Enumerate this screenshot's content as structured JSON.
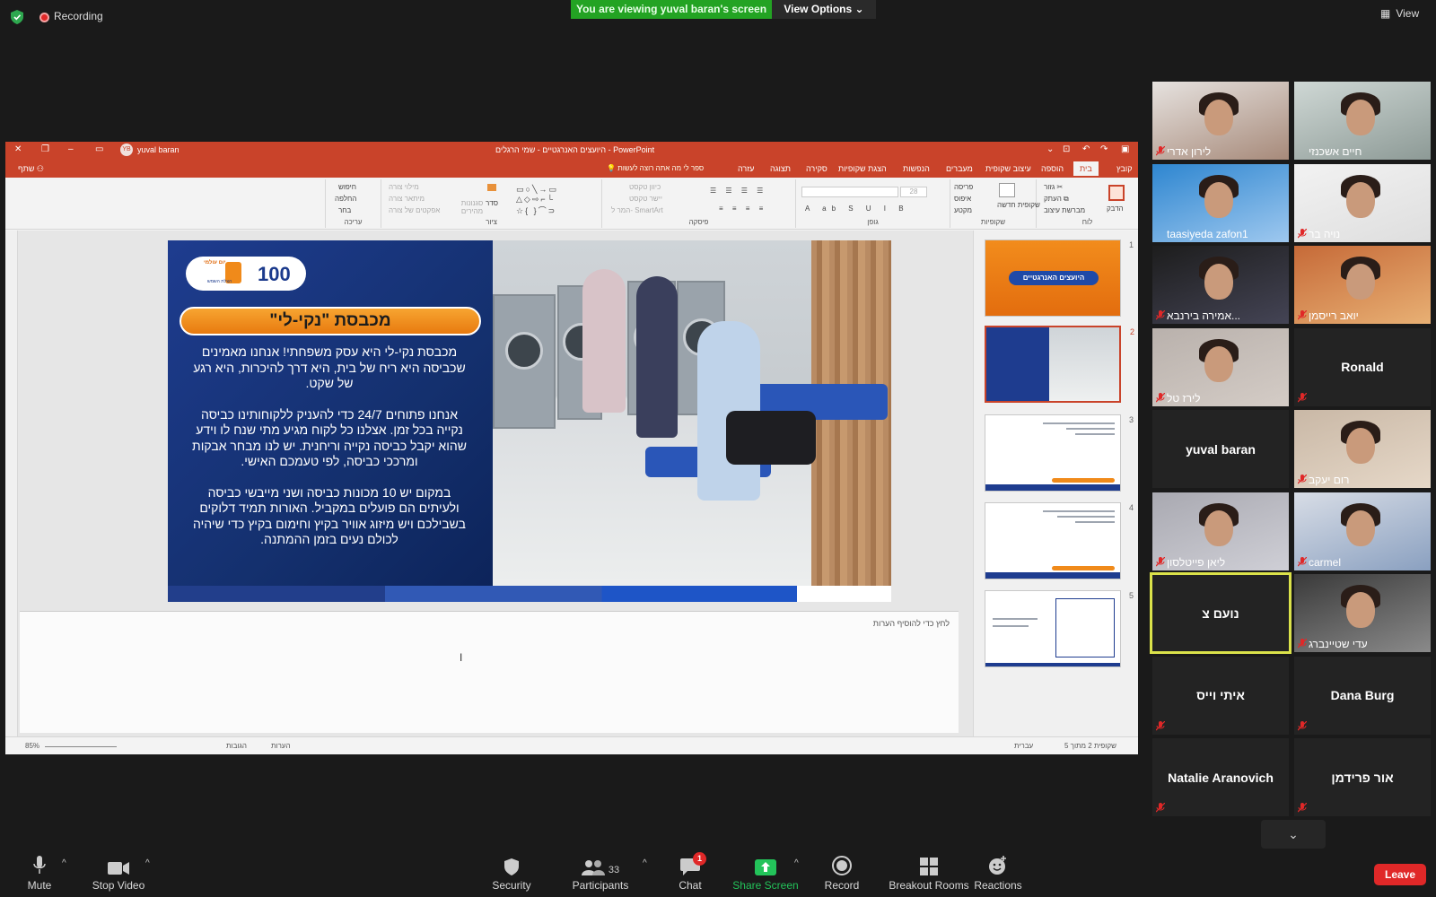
{
  "topbar": {
    "recording": "Recording",
    "viewing_banner": "You are viewing yuval baran's screen",
    "view_options": "View Options",
    "view": "View"
  },
  "ppt": {
    "title": "היועצים האנרגטיים - שמי הרגלים - PowerPoint",
    "user": "yuval baran",
    "user_initials": "YB",
    "share": "שתף",
    "tell_me": "ספר לי מה אתה רוצה לעשות",
    "tabs": [
      "קובץ",
      "בית",
      "הוספה",
      "עיצוב שקופית",
      "מעברים",
      "הנפשות",
      "הצגת שקופיות",
      "סקירה",
      "תצוגה",
      "עזרה"
    ],
    "ribbon": {
      "clipboard": {
        "paste": "הדבק",
        "cut": "גזור",
        "copy": "העתק",
        "format_painter": "מברשת עיצוב",
        "label": "לוח"
      },
      "slides": {
        "new_slide": "שקופית חדשה",
        "layout": "פריסה",
        "reset": "איפוס",
        "section": "מקטע",
        "label": "שקופיות"
      },
      "font": {
        "size": "28",
        "label": "גופן"
      },
      "paragraph": {
        "text_direction": "כיוון טקסט",
        "align_text": "יישר טקסט",
        "smartart": "המר ל- SmartArt",
        "label": "פיסקה"
      },
      "drawing": {
        "arrange": "סדר",
        "quick_styles": "סגנונות מהירים",
        "shape_fill": "מילוי צורה",
        "shape_outline": "מיתאר צורה",
        "shape_effects": "אפקטים של צורה",
        "label": "ציור"
      },
      "editing": {
        "find": "חיפוש",
        "replace": "החלפה",
        "select": "בחר",
        "label": "עריכה"
      }
    },
    "slide": {
      "title": "מכבסת \"נקי-לי\"",
      "logo_brand": "יום עולמי",
      "logo_sub": "הצלת השמש",
      "logo_num": "100",
      "paragraphs": [
        "מכבסת נקי-לי היא עסק משפחתי! אנחנו מאמינים שכביסה היא ריח של בית, היא דרך להיכרות, היא רגע של שקט.",
        "אנחנו פתוחים 24/7 כדי להעניק ללקוחותינו כביסה נקייה בכל זמן. אצלנו כל לקוח מגיע מתי שנח לו וידע שהוא יקבל כביסה נקייה וריחנית. יש לנו מבחר אבקות ומרככי כביסה, לפי טעמכם האישי.",
        "במקום יש 10 מכונות כביסה ושני מייבשי כביסה ולעיתים הם פועלים במקביל. האורות תמיד דלוקים בשבילכם ויש מיזוג אוויר בקיץ וחימום בקיץ כדי שיהיה לכולם נעים בזמן ההמתנה."
      ]
    },
    "thumb_title": "היועצים האנרגטיים",
    "notes_placeholder": "לחץ כדי להוסיף הערות",
    "status": {
      "slide": "שקופית 2 מתוך 5",
      "language": "עברית",
      "notes": "הערות",
      "comments": "הגובות",
      "zoom": "85%"
    },
    "thumb_numbers": [
      "1",
      "2",
      "3",
      "4",
      "5"
    ]
  },
  "gallery": [
    {
      "name": "לירון אדרי",
      "muted": true,
      "video": true
    },
    {
      "name": "חיים אשכנזי",
      "muted": false,
      "video": true
    },
    {
      "name": "taasiyeda zafon1",
      "muted": false,
      "video": true
    },
    {
      "name": "נויה בר",
      "muted": true,
      "video": true
    },
    {
      "name": "אמירה בירנבא...",
      "muted": true,
      "video": true
    },
    {
      "name": "יואב רייסמן",
      "muted": true,
      "video": true
    },
    {
      "name": "לירז טל",
      "muted": true,
      "video": true
    },
    {
      "name": "Ronald",
      "muted": true,
      "video": false
    },
    {
      "name": "yuval baran",
      "muted": false,
      "video": false
    },
    {
      "name": "רום יעקב",
      "muted": true,
      "video": true
    },
    {
      "name": "ליאן פייטלסון",
      "muted": true,
      "video": true
    },
    {
      "name": "carmel",
      "muted": true,
      "video": true
    },
    {
      "name": "נועם צ",
      "muted": false,
      "video": false,
      "active": true
    },
    {
      "name": "עדי שטיינברג",
      "muted": true,
      "video": true
    },
    {
      "name": "איתי וייס",
      "muted": true,
      "video": false
    },
    {
      "name": "Dana Burg",
      "muted": true,
      "video": false
    },
    {
      "name": "Natalie Aranovich",
      "muted": true,
      "video": false
    },
    {
      "name": "אור פרידמן",
      "muted": true,
      "video": false
    }
  ],
  "toolbar": {
    "mute": "Mute",
    "stop_video": "Stop Video",
    "security": "Security",
    "participants": "Participants",
    "participants_count": "33",
    "chat": "Chat",
    "chat_badge": "1",
    "share_screen": "Share Screen",
    "record": "Record",
    "breakout_rooms": "Breakout Rooms",
    "reactions": "Reactions",
    "leave": "Leave"
  },
  "colors": {
    "ppt_accent": "#c9432a",
    "zoom_green": "#23a323",
    "leave_red": "#e02828",
    "active_speaker": "#dbe24a"
  }
}
